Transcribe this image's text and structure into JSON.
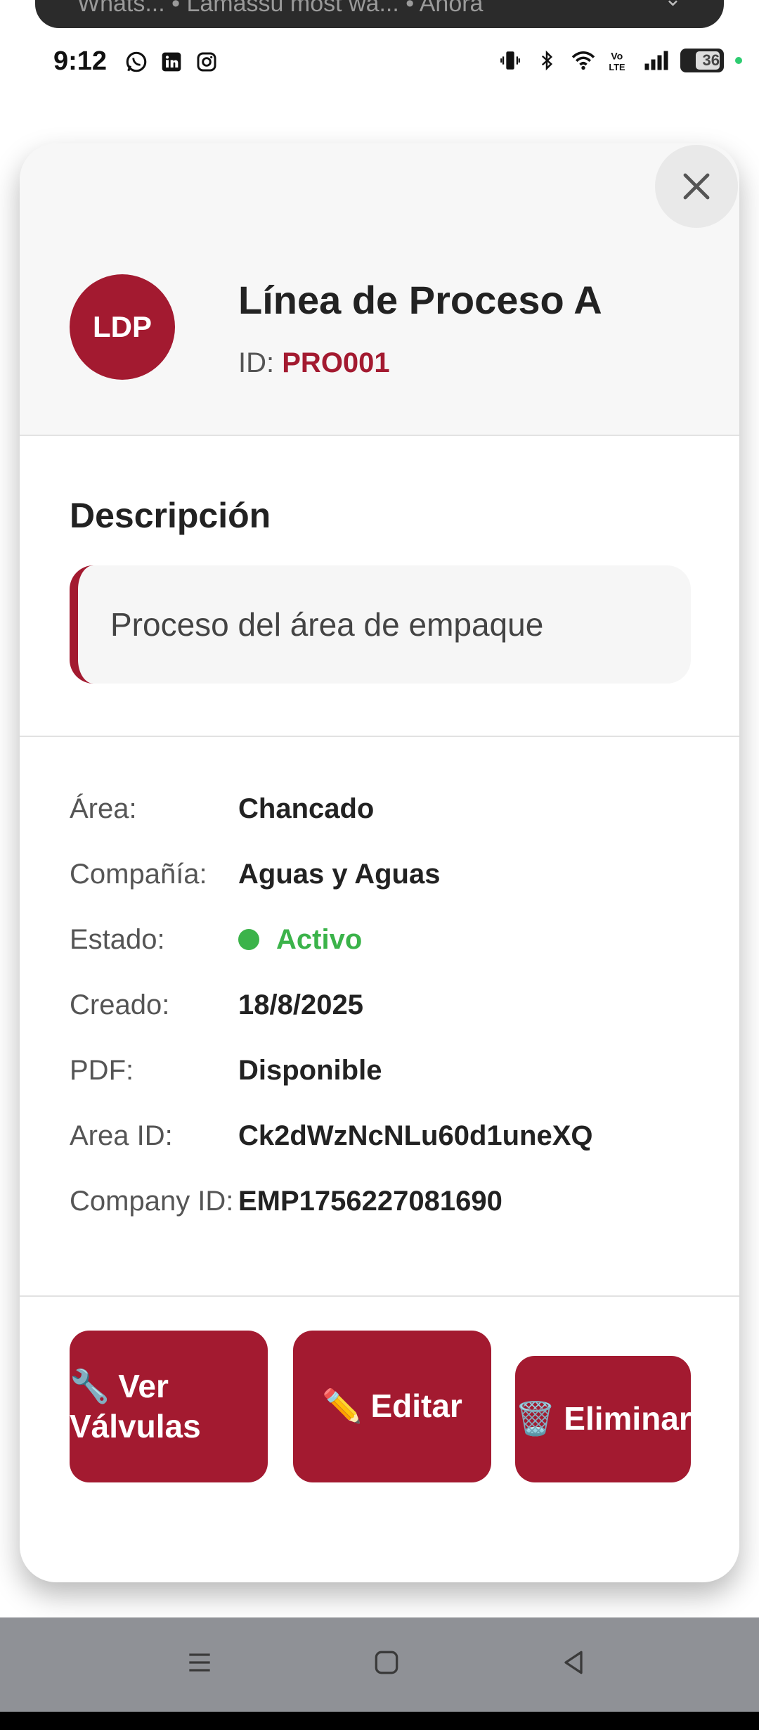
{
  "notification": {
    "text": "Whats...  •  Lamassu most wa...  •  Ahora"
  },
  "status_bar": {
    "time": "9:12",
    "battery": "36",
    "left_icons": [
      "whatsapp-icon",
      "linkedin-icon",
      "instagram-icon"
    ],
    "right_icons": [
      "vibrate-icon",
      "bluetooth-icon",
      "wifi-icon",
      "volte-icon",
      "signal-icon",
      "battery-icon"
    ]
  },
  "modal": {
    "avatar_initials": "LDP",
    "title": "Línea de Proceso A",
    "id_label": "ID:",
    "id_value": "PRO001",
    "description_title": "Descripción",
    "description_text": "Proceso del área de empaque",
    "info": [
      {
        "label": "Área:",
        "value": "Chancado"
      },
      {
        "label": "Compañía:",
        "value": "Aguas y Aguas"
      },
      {
        "label": "Estado:",
        "value": "Activo"
      },
      {
        "label": "Creado:",
        "value": "18/8/2025"
      },
      {
        "label": "PDF:",
        "value": "Disponible"
      },
      {
        "label": "Area ID:",
        "value": "Ck2dWzNcNLu60d1uneXQ"
      },
      {
        "label": "Company ID:",
        "value": "EMP1756227081690"
      }
    ],
    "buttons": {
      "valvulas_emoji": "🔧",
      "valvulas_line1": "Ver",
      "valvulas_line2": "Válvulas",
      "editar_emoji": "✏️",
      "editar_label": "Editar",
      "eliminar_emoji": "🗑️",
      "eliminar_label": "Eliminar"
    },
    "colors": {
      "accent": "#a31a30",
      "status_active": "#3bb34a"
    }
  },
  "nav_bar": {
    "icons": [
      "menu-icon",
      "home-icon",
      "back-icon"
    ]
  }
}
